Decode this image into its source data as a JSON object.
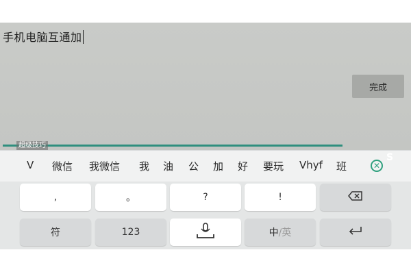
{
  "editor": {
    "text": "手机电脑互通加",
    "done_label": "完成",
    "watermark": "超级技巧"
  },
  "suggestions": {
    "candidates": [
      "V",
      "微信",
      "我微信",
      "我",
      "油",
      "公",
      "加",
      "好",
      "要玩",
      "Vhyf",
      "班"
    ],
    "close_icon": "close-suggestions-icon",
    "edge_logo": "S"
  },
  "keyboard": {
    "row1": [
      ",",
      "。",
      "?",
      "!"
    ],
    "backspace_icon": "backspace-icon",
    "row2": {
      "symbol": "符",
      "numeric": "123",
      "mic_icon": "microphone-icon",
      "lang_primary": "中",
      "lang_secondary": "/英",
      "enter_icon": "enter-icon"
    }
  },
  "colors": {
    "accent": "#2f8f7e",
    "editor_bg": "#c6c8c5",
    "keyboard_bg": "#e4e6e6",
    "key_bg": "#ffffff",
    "fn_key_bg": "#d7d9da"
  }
}
